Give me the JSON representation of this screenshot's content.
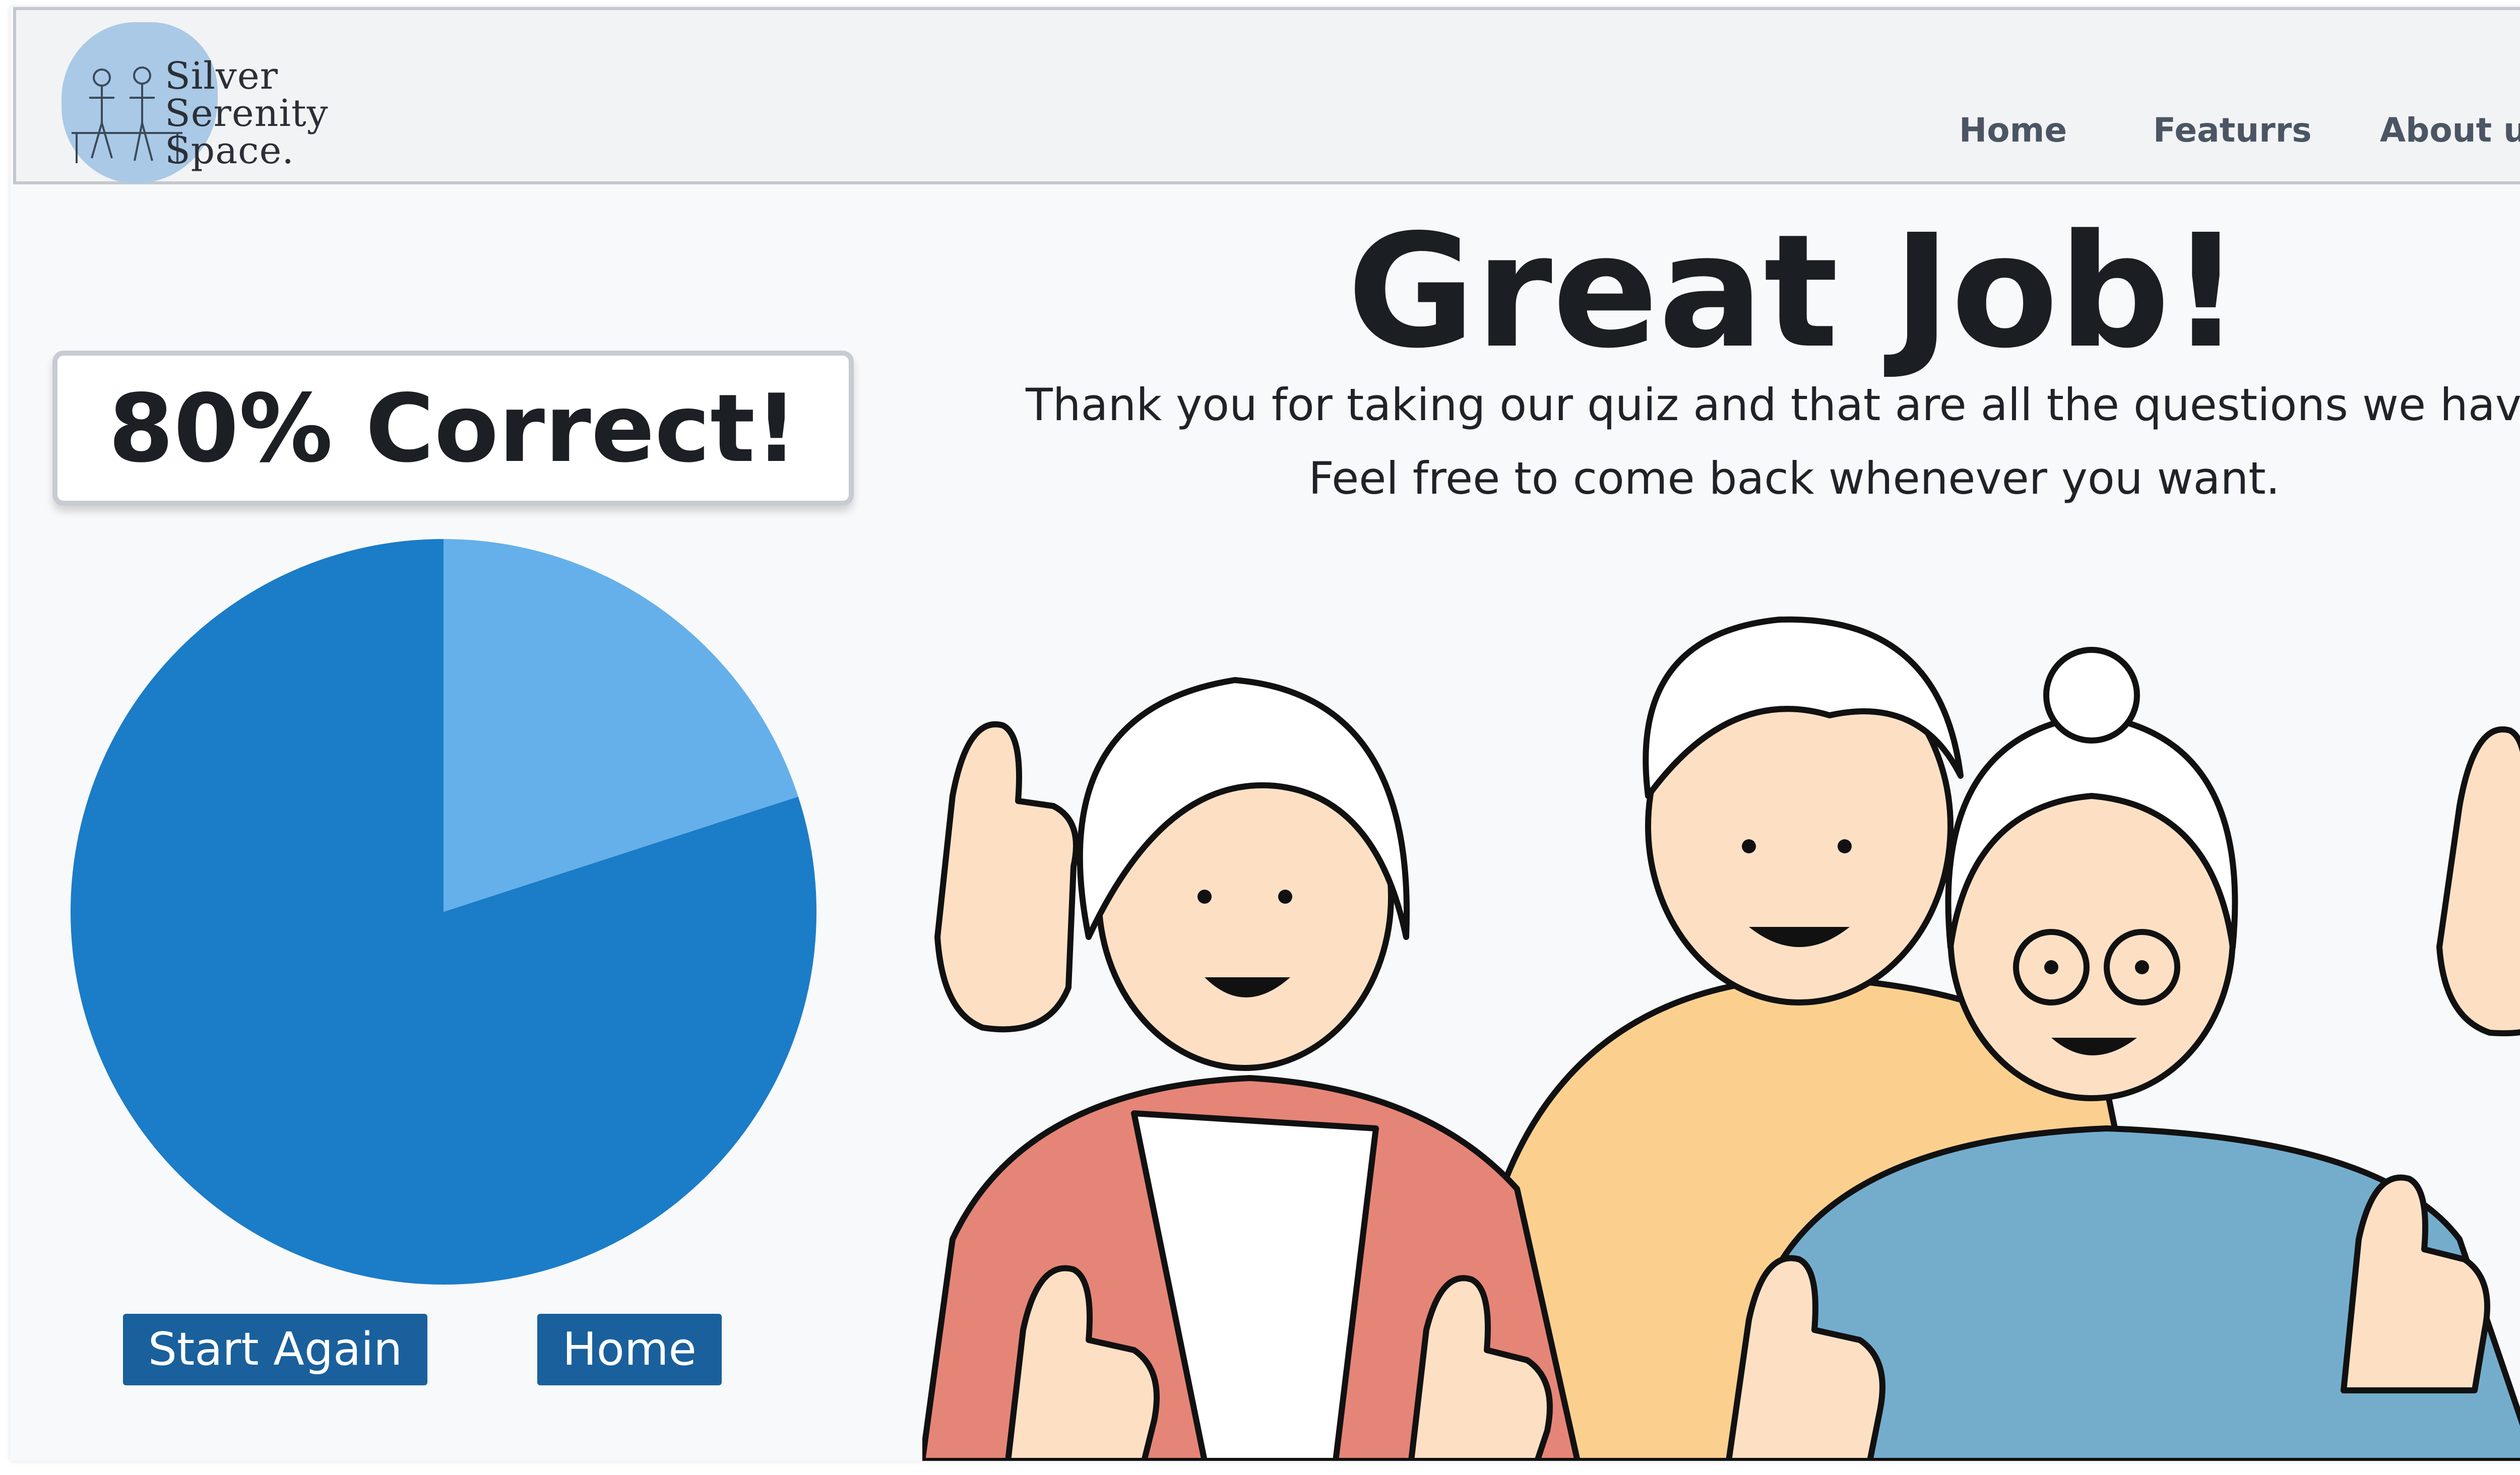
{
  "header": {
    "logo": {
      "line1": "Silver",
      "line2": "Serenity",
      "line3": "Space."
    },
    "nav": [
      {
        "label": "Home"
      },
      {
        "label": "Featurrs"
      },
      {
        "label": "About us"
      }
    ]
  },
  "result": {
    "score_label": "80% Correct!",
    "correct_percent": 80,
    "colors": {
      "correct": "#1b7cc8",
      "incorrect": "#65b0ea"
    }
  },
  "buttons": {
    "start_again": "Start Again",
    "home": "Home"
  },
  "main": {
    "heading": "Great Job!",
    "line1": "Thank you for taking our quiz and that are all the questions we have.",
    "line2": "Feel free to come back whenever you want."
  },
  "illustration": {
    "subject": "three-seniors-thumbs-up"
  }
}
